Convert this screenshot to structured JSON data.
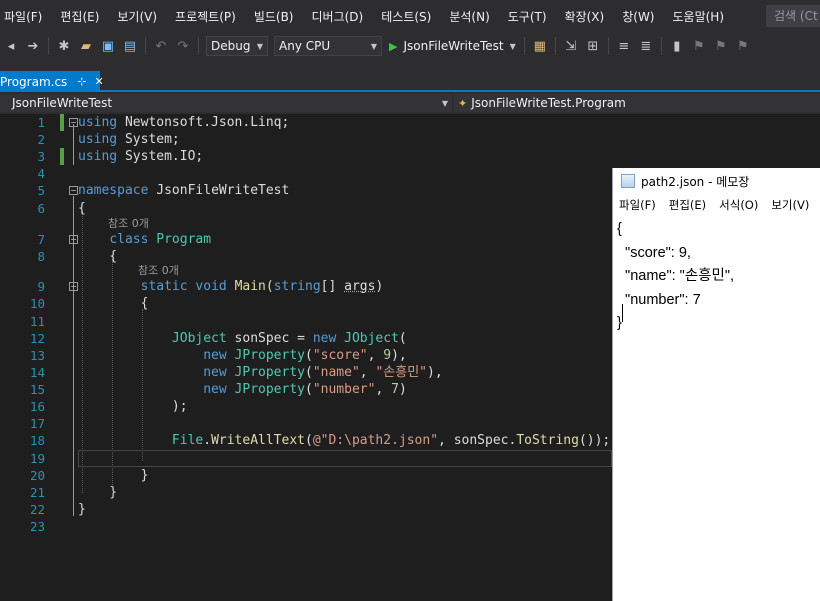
{
  "menu": {
    "items": [
      "파일(F)",
      "편집(E)",
      "보기(V)",
      "프로젝트(P)",
      "빌드(B)",
      "디버그(D)",
      "테스트(S)",
      "분석(N)",
      "도구(T)",
      "확장(X)",
      "창(W)",
      "도움말(H)"
    ],
    "search_placeholder": "검색 (Ct"
  },
  "toolbar": {
    "configuration": "Debug",
    "platform": "Any CPU",
    "start_label": "JsonFileWriteTest"
  },
  "tab": {
    "filename": "Program.cs",
    "pin_glyph": "⊹",
    "close_glyph": "✕"
  },
  "navbar": {
    "project": "JsonFileWriteTest",
    "member": "JsonFileWriteTest.Program"
  },
  "editor": {
    "line_numbers": [
      "1",
      "2",
      "3",
      "4",
      "5",
      "6",
      "7",
      "8",
      "9",
      "10",
      "11",
      "12",
      "13",
      "14",
      "15",
      "16",
      "17",
      "18",
      "19",
      "20",
      "21",
      "22",
      "23"
    ],
    "codelens_class": "참조 0개",
    "codelens_main": "참조 0개"
  },
  "notepad": {
    "title": "path2.json - 메모장",
    "menu": [
      "파일(F)",
      "편집(E)",
      "서식(O)",
      "보기(V)"
    ],
    "content": "{\n  \"score\": 9,\n  \"name\": \"손흥민\",\n  \"number\": 7\n}"
  },
  "colors": {
    "accent": "#007acc",
    "editor_bg": "#1e1e1e",
    "keyword": "#569cd6",
    "type": "#4ec9b0",
    "string": "#d69d85",
    "number": "#b5cea8",
    "method": "#dcdcaa",
    "line_number": "#2b91af",
    "run_green": "#35c83e"
  }
}
